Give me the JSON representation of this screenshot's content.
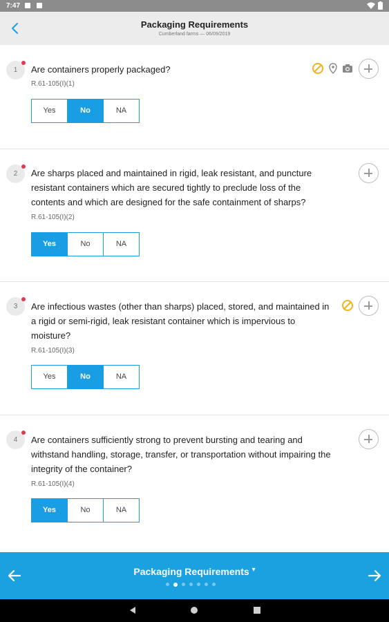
{
  "status_bar": {
    "time": "7:47"
  },
  "header": {
    "title": "Packaging Requirements",
    "subtitle": "Cumberland farms — 06/09/2019"
  },
  "questions": [
    {
      "number": "1",
      "text": "Are containers properly packaged?",
      "ref": "R.61-105(I)(1)",
      "options": [
        "Yes",
        "No",
        "NA"
      ],
      "selected": "No",
      "icons": [
        "not-applicable-icon",
        "location-pin-icon",
        "camera-icon"
      ]
    },
    {
      "number": "2",
      "text": "Are sharps placed and maintained in rigid, leak resistant, and puncture resistant containers which are secured tightly to preclude loss of the contents and which are designed for the safe containment of sharps?",
      "ref": "R.61-105(I)(2)",
      "options": [
        "Yes",
        "No",
        "NA"
      ],
      "selected": "Yes",
      "icons": []
    },
    {
      "number": "3",
      "text": "Are infectious wastes (other than sharps) placed, stored, and maintained in a rigid or semi-rigid, leak resistant container which is impervious to moisture?",
      "ref": "R.61-105(I)(3)",
      "options": [
        "Yes",
        "No",
        "NA"
      ],
      "selected": "No",
      "icons": [
        "not-applicable-icon"
      ]
    },
    {
      "number": "4",
      "text": "Are containers sufficiently strong to prevent bursting and tearing and withstand handling, storage, transfer, or transportation without impairing the integrity of the container?",
      "ref": "R.61-105(I)(4)",
      "options": [
        "Yes",
        "No",
        "NA"
      ],
      "selected": "Yes",
      "icons": []
    }
  ],
  "footer": {
    "section_title": "Packaging Requirements",
    "dropdown_glyph": "▾",
    "page_count": 7,
    "current_page": 2
  },
  "colors": {
    "accent": "#1ba0e0",
    "required": "#e0384d",
    "warning": "#f2b21b"
  }
}
